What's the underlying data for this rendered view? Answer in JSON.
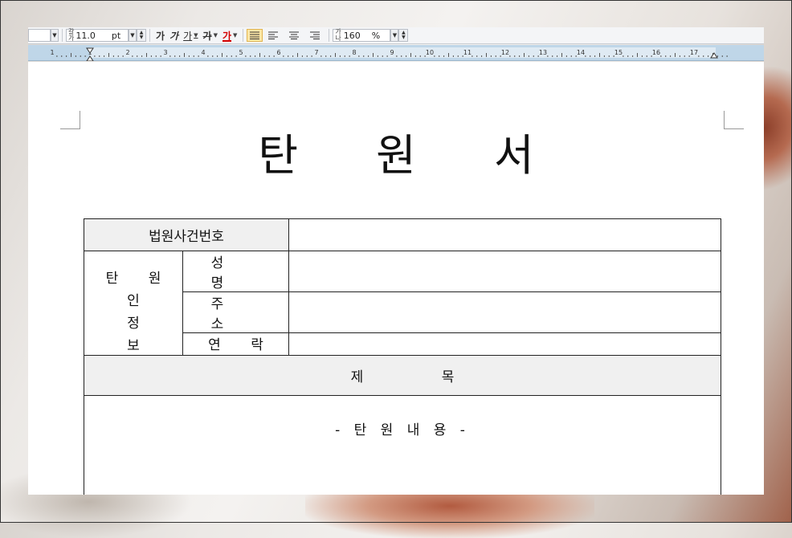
{
  "toolbar": {
    "font_size_value": "11.0",
    "font_size_unit": "pt",
    "bold_label": "가",
    "italic_label": "가",
    "underline_label": "가",
    "strike_label": "가",
    "color_label": "가",
    "line_spacing_value": "160",
    "line_spacing_unit": "%",
    "font_color": "#d40000",
    "align_options": [
      "justify",
      "left",
      "center",
      "right"
    ],
    "active_align": "justify"
  },
  "ruler": {
    "labels": [
      "1",
      "1",
      "2",
      "3",
      "4",
      "5",
      "6",
      "7",
      "8",
      "9",
      "10",
      "11",
      "12",
      "13",
      "14",
      "15",
      "16",
      "17"
    ]
  },
  "document": {
    "title": "탄 원 서",
    "case_number_label": "법원사건번호",
    "petitioner_label_line1": "탄 원 인",
    "petitioner_label_line2": "정 보",
    "name_label": "성 명",
    "address_label": "주 소",
    "contact_label": "연 락 처",
    "subject_label": "제 목",
    "content_placeholder": "- 탄 원 내 용 -",
    "case_number_value": "",
    "name_value": "",
    "address_value": "",
    "contact_value": ""
  }
}
